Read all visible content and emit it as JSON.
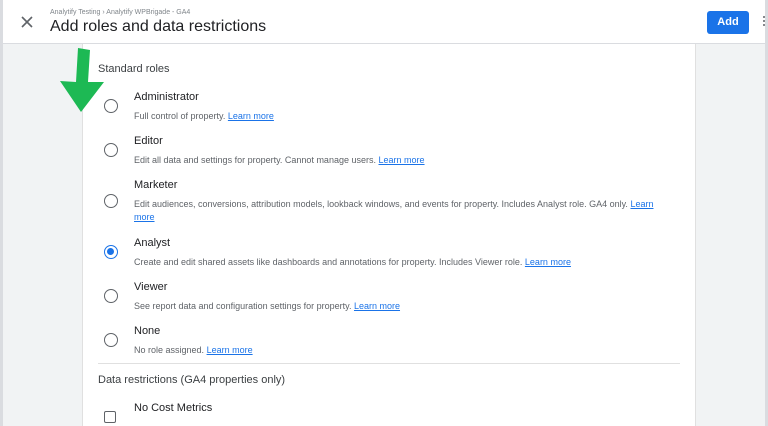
{
  "header": {
    "breadcrumb": "Analytify Testing › Analytify WPBrigade - GA4",
    "title": "Add roles and data restrictions",
    "add_label": "Add"
  },
  "standard_roles": {
    "title": "Standard roles",
    "roles": [
      {
        "name": "Administrator",
        "description": "Full control of property.",
        "link": "Learn more",
        "selected": false
      },
      {
        "name": "Editor",
        "description": "Edit all data and settings for property. Cannot manage users.",
        "link": "Learn more",
        "selected": false
      },
      {
        "name": "Marketer",
        "description": "Edit audiences, conversions, attribution models, lookback windows, and events for property. Includes Analyst role. GA4 only.",
        "link": "Learn more",
        "selected": false
      },
      {
        "name": "Analyst",
        "description": "Create and edit shared assets like dashboards and annotations for property. Includes Viewer role.",
        "link": "Learn more",
        "selected": true
      },
      {
        "name": "Viewer",
        "description": "See report data and configuration settings for property.",
        "link": "Learn more",
        "selected": false
      },
      {
        "name": "None",
        "description": "No role assigned.",
        "link": "Learn more",
        "selected": false
      }
    ]
  },
  "data_restrictions": {
    "title": "Data restrictions (GA4 properties only)",
    "items": [
      {
        "name": "No Cost Metrics",
        "checked": false
      }
    ]
  },
  "colors": {
    "accent": "#1a73e8",
    "arrow": "#1db954"
  }
}
